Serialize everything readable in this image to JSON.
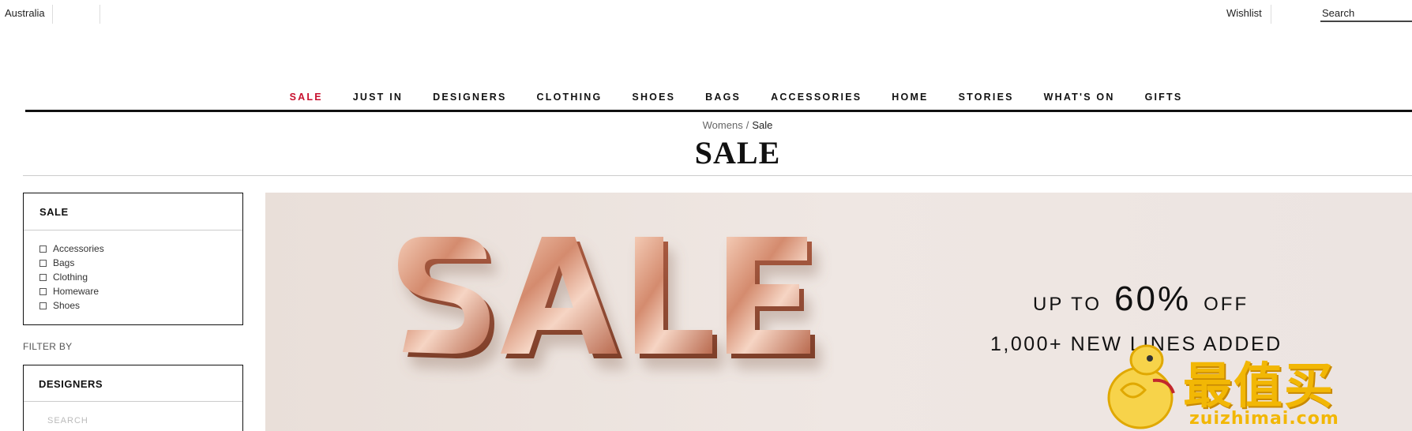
{
  "topbar": {
    "country": "Australia",
    "wishlist": "Wishlist",
    "search_placeholder": "Search"
  },
  "nav": {
    "items": [
      {
        "label": "SALE",
        "highlight": "#c8102e"
      },
      {
        "label": "JUST IN"
      },
      {
        "label": "DESIGNERS"
      },
      {
        "label": "CLOTHING"
      },
      {
        "label": "SHOES"
      },
      {
        "label": "BAGS"
      },
      {
        "label": "ACCESSORIES"
      },
      {
        "label": "HOME"
      },
      {
        "label": "STORIES"
      },
      {
        "label": "WHAT'S ON"
      },
      {
        "label": "GIFTS"
      }
    ]
  },
  "breadcrumb": {
    "parent": "Womens",
    "separator": "/",
    "current": "Sale"
  },
  "page_title": "SALE",
  "sidebar": {
    "category_title": "SALE",
    "categories": [
      "Accessories",
      "Bags",
      "Clothing",
      "Homeware",
      "Shoes"
    ],
    "filter_by": "FILTER BY",
    "designers_title": "DESIGNERS",
    "designers_search_placeholder": "SEARCH"
  },
  "hero": {
    "word": "SALE",
    "promo_prefix": "UP TO",
    "promo_value": "60%",
    "promo_suffix": "OFF",
    "promo_line2": "1,000+ NEW LINES ADDED"
  },
  "watermark": {
    "text": "最值买",
    "site": "zuizhimai.com"
  },
  "colors": {
    "sale_red": "#c8102e",
    "hero_bg": "#ece3de",
    "rose_gold": "#d08d72",
    "watermark_yellow": "#f2b705"
  }
}
